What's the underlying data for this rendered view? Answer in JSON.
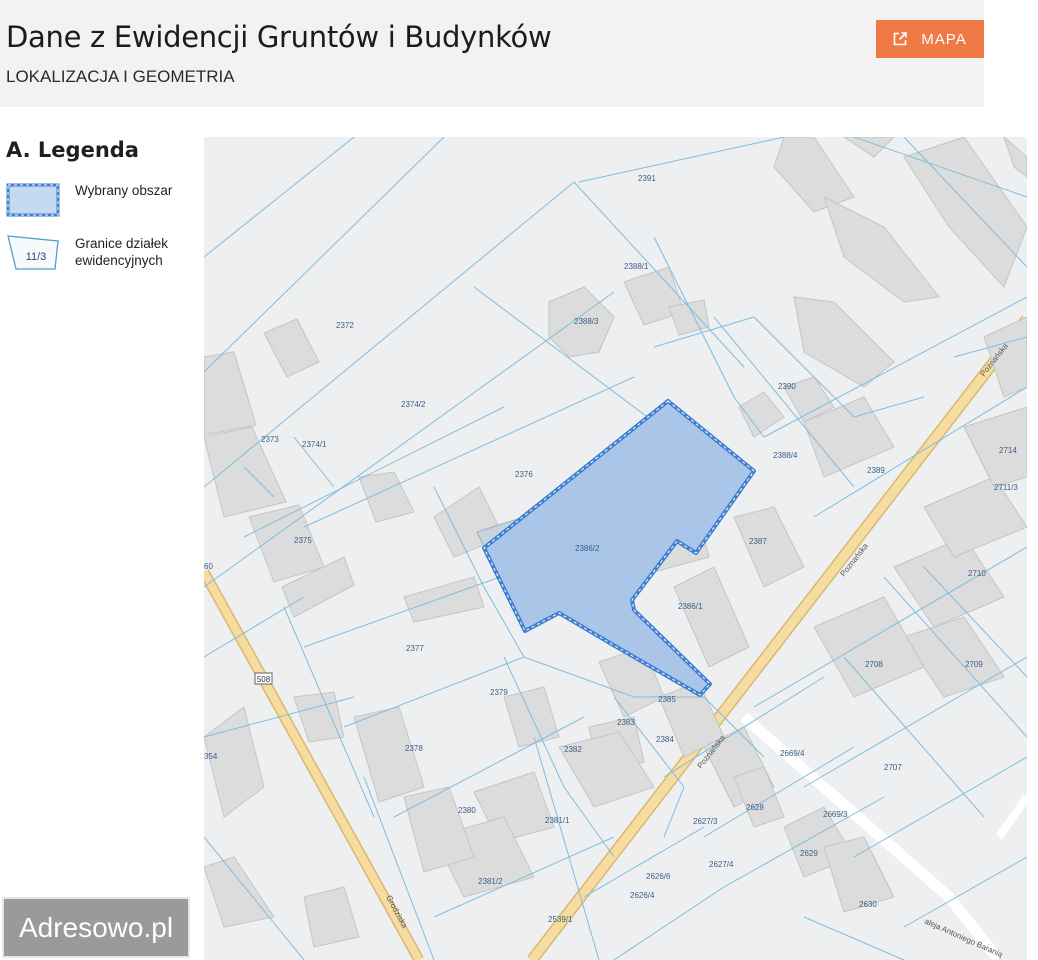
{
  "header": {
    "title": "Dane z Ewidencji Gruntów i Budynków",
    "subtitle": "LOKALIZACJA I GEOMETRIA",
    "map_button_label": "MAPA",
    "map_button_icon": "external-link-icon",
    "accent_color": "#f07a45"
  },
  "legend": {
    "title": "A. Legenda",
    "items": [
      {
        "label": "Wybrany obszar",
        "icon": "selected-area-swatch"
      },
      {
        "label": "Granice działek ewidencyjnych",
        "icon": "parcel-boundary-swatch",
        "sample": "11/3"
      }
    ]
  },
  "map": {
    "selection_color": "#a9c6e8",
    "parcel_line_color": "#7fbde0",
    "road_color": "#f6dca0",
    "parcels": [
      "2391",
      "2388/1",
      "2388/3",
      "2372",
      "2390",
      "2374/2",
      "2373",
      "2374/1",
      "2376",
      "2388/4",
      "2389",
      "2714",
      "2711/3",
      "2386/2",
      "2387",
      "2375",
      "60",
      "2710",
      "2386/1",
      "2377",
      "2708",
      "2709",
      "2379",
      "2385",
      "2383",
      "2384",
      "2378",
      "2382",
      "2707",
      "2669/4",
      "354",
      "2380",
      "2381/1",
      "2628",
      "2669/3",
      "2627/3",
      "2629",
      "2627/4",
      "2381/2",
      "2626/6",
      "2626/4",
      "2630",
      "2539/1"
    ],
    "streets": [
      "Poznańska",
      "Poznańska",
      "Poznańska",
      "Grodziska",
      "aleja Antoniego Baranią"
    ],
    "road_shield": "508"
  },
  "watermark": "Adresowo.pl"
}
